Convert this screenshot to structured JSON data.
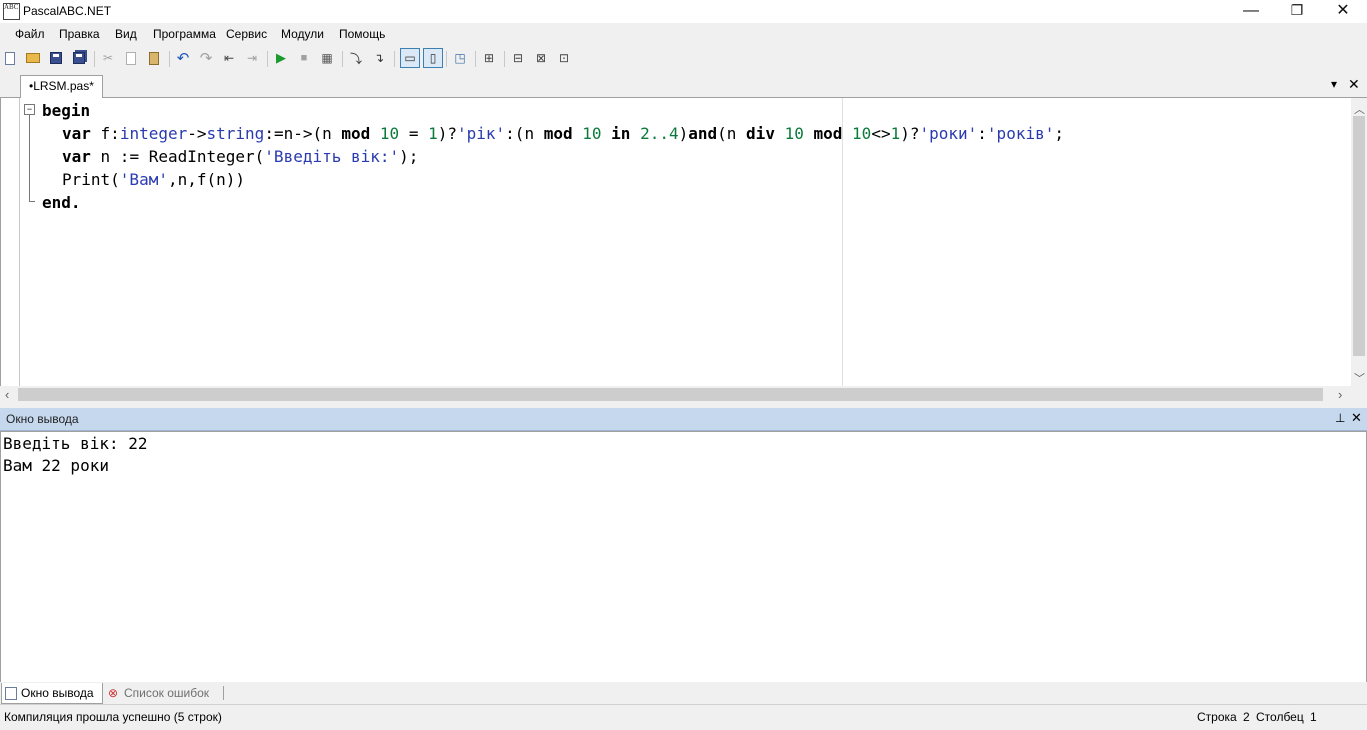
{
  "window": {
    "title": "PascalABC.NET",
    "icon_text": "ABC",
    "minimize": "—",
    "maximize": "❐",
    "close": "✕"
  },
  "menu": [
    "Файл",
    "Правка",
    "Вид",
    "Программа",
    "Сервис",
    "Модули",
    "Помощь"
  ],
  "toolbar": {
    "icons": [
      "new-file-icon",
      "open-folder-icon",
      "save-icon",
      "save-all-icon",
      "cut-icon",
      "copy-icon",
      "paste-icon",
      "undo-icon",
      "redo-icon",
      "indent-icon",
      "unindent-icon",
      "run-icon",
      "stop-icon",
      "debug-icon",
      "step-icon",
      "step-over-icon",
      "toggle-output-icon",
      "toggle-errors-icon",
      "breakpoint-icon",
      "form-icon",
      "module-icon",
      "find-icon",
      "replace-icon"
    ]
  },
  "editor": {
    "tab_label": "•LRSM.pas*",
    "tab_menu": "▾",
    "tab_close": "✕",
    "fold_symbol": "−",
    "code": {
      "begin": "begin",
      "end": "end.",
      "l2_var": "var",
      "l2_a": " f:",
      "l2_integer": "integer",
      "l2_b": "->",
      "l2_string": "string",
      "l2_c": ":=n->(n ",
      "l2_mod1": "mod",
      "l2_d": " ",
      "l2_10a": "10",
      "l2_e": " = ",
      "l2_1a": "1",
      "l2_f": ")?",
      "l2_rik": "'рік'",
      "l2_g": ":(n ",
      "l2_mod2": "mod",
      "l2_h": " ",
      "l2_10b": "10",
      "l2_i": " ",
      "l2_in": "in",
      "l2_j": " ",
      "l2_range": "2..4",
      "l2_k": ")",
      "l2_and": "and",
      "l2_l": "(n ",
      "l2_div": "div",
      "l2_m": " ",
      "l2_10c": "10",
      "l2_n": " ",
      "l2_mod3": "mod",
      "l2_o": " ",
      "l2_10d": "10",
      "l2_p": "<>",
      "l2_1b": "1",
      "l2_q": ")?",
      "l2_roky": "'роки'",
      "l2_r": ":",
      "l2_rokiv": "'років'",
      "l2_s": ";",
      "l3_var": "var",
      "l3_a": " n := ReadInteger(",
      "l3_str": "'Введіть вік:'",
      "l3_b": ");",
      "l4_a": "Print(",
      "l4_str": "'Вам'",
      "l4_b": ",n,f(n))"
    }
  },
  "output_panel": {
    "title": "Окно вывода",
    "pin": "⊥",
    "close": "✕",
    "lines": [
      "Введіть вік: 22",
      "Вам 22 роки"
    ]
  },
  "bottom_tabs": [
    "Окно вывода",
    "Список ошибок"
  ],
  "status": {
    "message": "Компиляция прошла успешно (5 строк)",
    "line_label": "Строка",
    "line_value": "2",
    "col_label": "Столбец",
    "col_value": "1"
  }
}
